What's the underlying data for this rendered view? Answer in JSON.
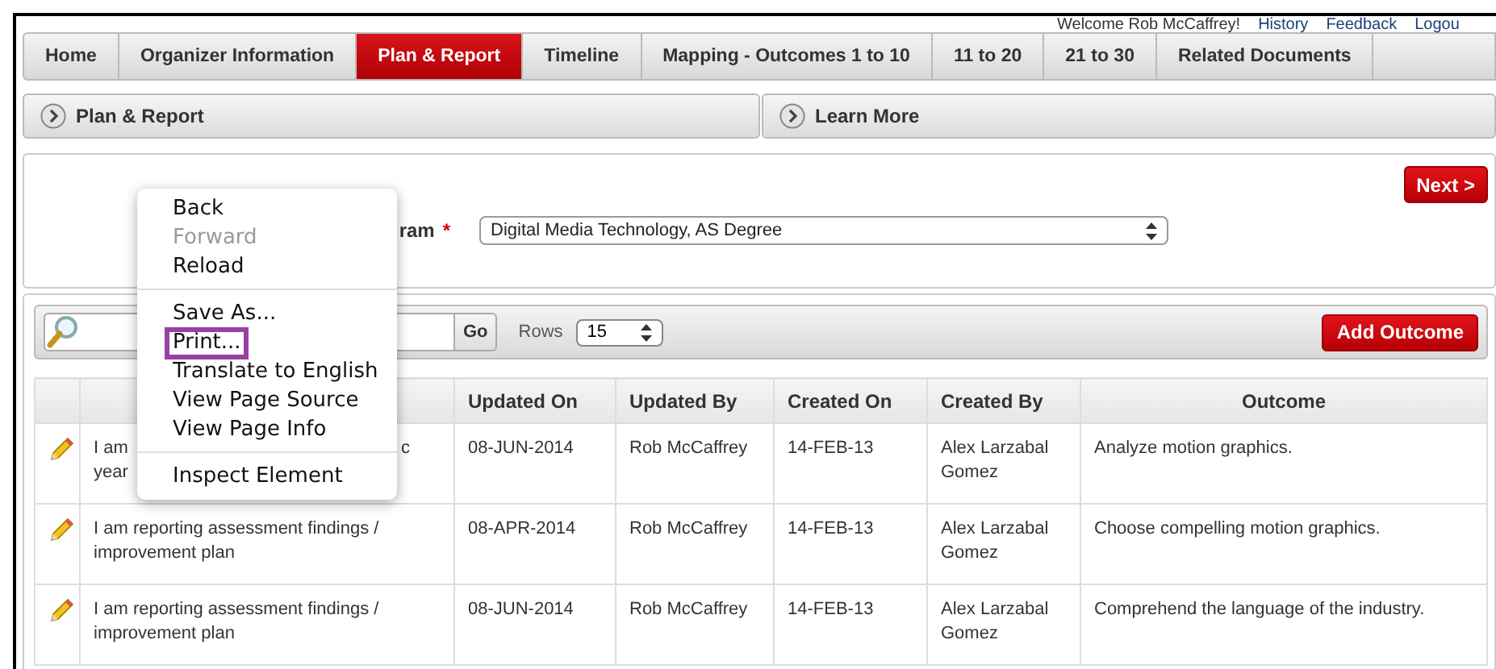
{
  "header_links": [
    {
      "text": "Welcome Rob McCaffrey!",
      "kind": "text"
    },
    {
      "text": "History",
      "kind": "link"
    },
    {
      "text": "Feedback",
      "kind": "link"
    },
    {
      "text": "Logou",
      "kind": "link"
    }
  ],
  "tabs": [
    {
      "label": "Home",
      "selected": false
    },
    {
      "label": "Organizer Information",
      "selected": false
    },
    {
      "label": "Plan & Report",
      "selected": true
    },
    {
      "label": "Timeline",
      "selected": false
    },
    {
      "label": "Mapping - Outcomes 1 to 10",
      "selected": false
    },
    {
      "label": "11 to 20",
      "selected": false
    },
    {
      "label": "21 to 30",
      "selected": false
    },
    {
      "label": "Related Documents",
      "selected": false
    }
  ],
  "section_bars": [
    "Plan & Report",
    "Learn More"
  ],
  "program_region": {
    "next_button": "Next >",
    "label": "ram",
    "required_mark": "*",
    "value": "Digital Media Technology, AS Degree"
  },
  "report": {
    "go_button": "Go",
    "rows_label": "Rows",
    "rows_value": "15",
    "add_button": "Add Outcome",
    "columns": [
      "",
      "",
      "Updated On",
      "Updated By",
      "Created On",
      "Created By",
      "Outcome"
    ],
    "rows": [
      {
        "report_lines": [
          [
            "I am",
            "c"
          ],
          [
            "year"
          ]
        ],
        "updated_on": "08-JUN-2014",
        "updated_by": "Rob McCaffrey",
        "created_on": "14-FEB-13",
        "created_by": "Alex Larzabal Gomez",
        "outcome": "Analyze motion graphics."
      },
      {
        "report_lines": [
          [
            "I am reporting assessment findings /"
          ],
          [
            "improvement plan"
          ]
        ],
        "updated_on": "08-APR-2014",
        "updated_by": "Rob McCaffrey",
        "created_on": "14-FEB-13",
        "created_by": "Alex Larzabal Gomez",
        "outcome": "Choose compelling motion graphics."
      },
      {
        "report_lines": [
          [
            "I am reporting assessment findings /"
          ],
          [
            "improvement plan"
          ]
        ],
        "updated_on": "08-JUN-2014",
        "updated_by": "Rob McCaffrey",
        "created_on": "14-FEB-13",
        "created_by": "Alex Larzabal Gomez",
        "outcome": "Comprehend the language of the industry."
      }
    ]
  },
  "context_menu": [
    {
      "kind": "item",
      "label": "Back",
      "disabled": false,
      "highlighted": false
    },
    {
      "kind": "item",
      "label": "Forward",
      "disabled": true,
      "highlighted": false
    },
    {
      "kind": "item",
      "label": "Reload",
      "disabled": false,
      "highlighted": false
    },
    {
      "kind": "separator"
    },
    {
      "kind": "item",
      "label": "Save As...",
      "disabled": false,
      "highlighted": false
    },
    {
      "kind": "item",
      "label": "Print...",
      "disabled": false,
      "highlighted": true
    },
    {
      "kind": "item",
      "label": "Translate to English",
      "disabled": false,
      "highlighted": false
    },
    {
      "kind": "item",
      "label": "View Page Source",
      "disabled": false,
      "highlighted": false
    },
    {
      "kind": "item",
      "label": "View Page Info",
      "disabled": false,
      "highlighted": false
    },
    {
      "kind": "separator"
    },
    {
      "kind": "item",
      "label": "Inspect Element",
      "disabled": false,
      "highlighted": false
    }
  ]
}
